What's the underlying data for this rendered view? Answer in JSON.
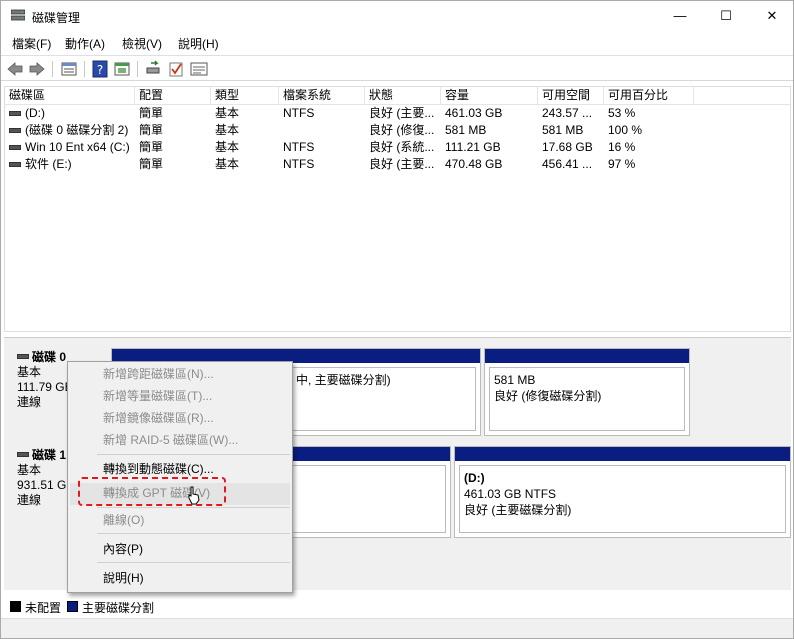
{
  "window": {
    "title": "磁碟管理",
    "minimize": "—",
    "maximize": "☐",
    "close": "✕"
  },
  "menu": [
    "檔案(F)",
    "動作(A)",
    "檢視(V)",
    "說明(H)"
  ],
  "toolbar": {
    "icons": [
      "back-icon",
      "forward-icon",
      "list-view-icon",
      "help-icon",
      "properties-icon",
      "rescan-icon",
      "check-icon",
      "details-icon"
    ]
  },
  "table": {
    "headers": [
      "磁碟區",
      "配置",
      "類型",
      "檔案系統",
      "狀態",
      "容量",
      "可用空間",
      "可用百分比"
    ],
    "rows": [
      [
        "(D:)",
        "簡單",
        "基本",
        "NTFS",
        "良好 (主要...",
        "461.03 GB",
        "243.57 ...",
        "53 %"
      ],
      [
        "(磁碟 0 磁碟分割 2)",
        "簡單",
        "基本",
        "",
        "良好 (修復...",
        "581 MB",
        "581 MB",
        "100 %"
      ],
      [
        "Win 10 Ent x64 (C:)",
        "簡單",
        "基本",
        "NTFS",
        "良好 (系統...",
        "111.21 GB",
        "17.68 GB",
        "16 %"
      ],
      [
        "软件 (E:)",
        "簡單",
        "基本",
        "NTFS",
        "良好 (主要...",
        "470.48 GB",
        "456.41 ...",
        "97 %"
      ]
    ]
  },
  "disks": [
    {
      "name": "磁碟 0",
      "type": "基本",
      "size": "111.79 GE",
      "status": "連線",
      "partitions": [
        {
          "line1": "",
          "line2": "",
          "line3": "中, 主要磁碟分割)"
        },
        {
          "line1": "",
          "line2": "581 MB",
          "line3": "良好 (修復磁碟分割)"
        }
      ]
    },
    {
      "name": "磁碟 1",
      "type": "基本",
      "size": "931.51 GE",
      "status": "連線",
      "partitions": [
        {
          "line1": "",
          "line2": "",
          "line3": ""
        },
        {
          "line1": "(D:)",
          "line2": "461.03 GB NTFS",
          "line3": "良好 (主要磁碟分割)"
        }
      ]
    }
  ],
  "context_menu": {
    "items": [
      {
        "label": "新增跨距磁碟區(N)...",
        "enabled": false
      },
      {
        "label": "新增等量磁碟區(T)...",
        "enabled": false
      },
      {
        "label": "新增鏡像磁碟區(R)...",
        "enabled": false
      },
      {
        "label": "新增 RAID-5 磁碟區(W)...",
        "enabled": false
      },
      {
        "label": "轉換到動態磁碟(C)...",
        "enabled": true
      },
      {
        "label": "轉換成 GPT 磁碟(V)",
        "enabled": false
      },
      {
        "label": "離線(O)",
        "enabled": false
      },
      {
        "label": "內容(P)",
        "enabled": true
      },
      {
        "label": "說明(H)",
        "enabled": true
      }
    ]
  },
  "legend": [
    {
      "label": "未配置",
      "color": "#000000"
    },
    {
      "label": "主要磁碟分割",
      "color": "#0a1e82"
    }
  ],
  "colors": {
    "partition_bar": "#0a1e82",
    "highlight_box": "#e0191b"
  }
}
